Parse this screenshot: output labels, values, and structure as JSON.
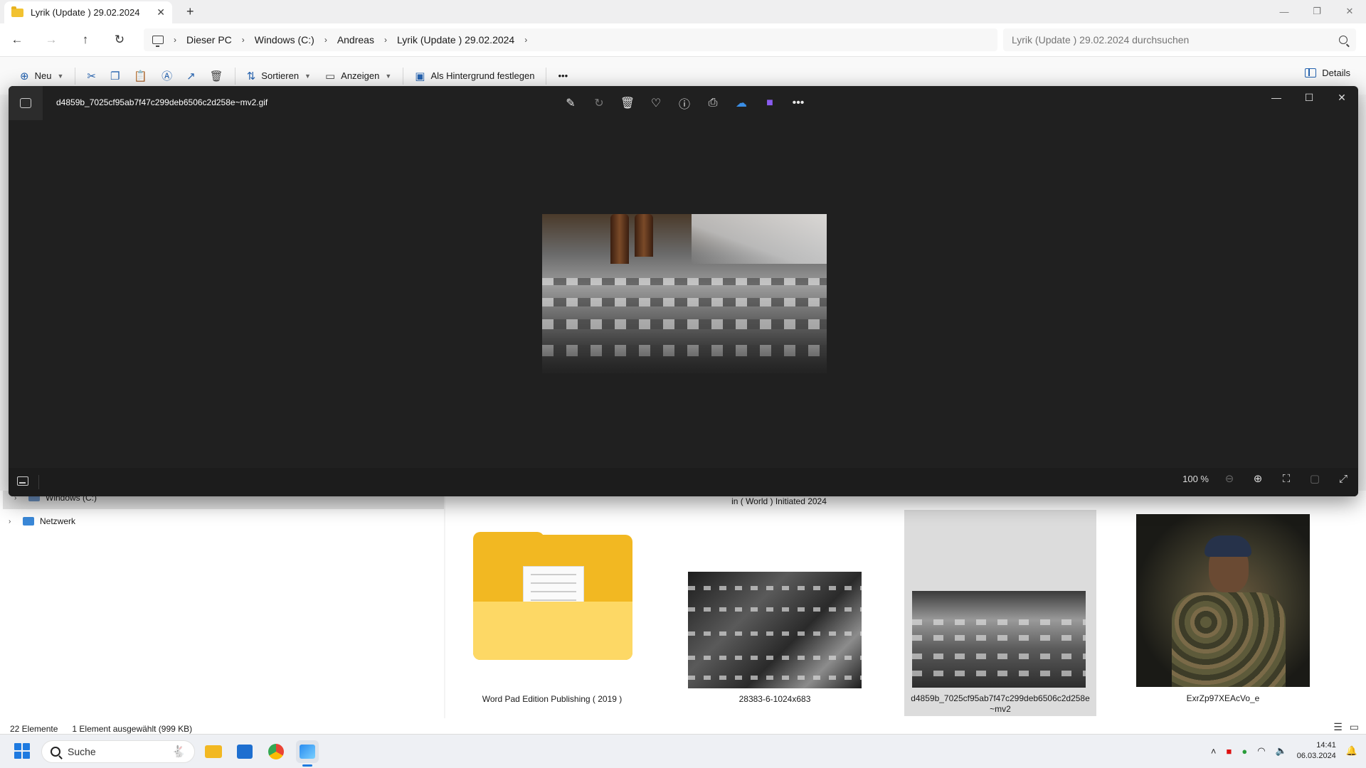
{
  "window": {
    "tab_title": "Lyrik (Update ) 29.02.2024",
    "new_tab_symbol": "+",
    "close_tab_symbol": "✕",
    "minimize_symbol": "—",
    "restore_symbol": "❐",
    "close_symbol": "✕"
  },
  "nav": {
    "back_symbol": "←",
    "forward_symbol": "→",
    "up_symbol": "↑",
    "refresh_symbol": "↻"
  },
  "breadcrumbs": [
    "Dieser PC",
    "Windows (C:)",
    "Andreas",
    "Lyrik (Update ) 29.02.2024"
  ],
  "search": {
    "placeholder": "Lyrik (Update ) 29.02.2024 durchsuchen"
  },
  "commandbar": {
    "new_label": "Neu",
    "sort_label": "Sortieren",
    "view_label": "Anzeigen",
    "wallpaper_label": "Als Hintergrund festlegen",
    "more_symbol": "•••",
    "details_label": "Details",
    "icons": [
      "plus-icon",
      "cut-icon",
      "copy-icon",
      "paste-icon",
      "rename-icon",
      "share-icon",
      "delete-icon"
    ]
  },
  "viewer": {
    "filename": "d4859b_7025cf95ab7f47c299deb6506c2d258e~mv2.gif",
    "zoom": "100 %",
    "more_symbol": "•••",
    "tools": [
      "edit-image-icon",
      "rotate-icon",
      "delete-icon",
      "favorite-heart-icon",
      "info-icon",
      "print-icon",
      "onedrive-icon",
      "clipchamp-icon"
    ]
  },
  "tree": {
    "items": [
      {
        "label": "Windows (C:)"
      },
      {
        "label": "Netzwerk"
      }
    ]
  },
  "files": {
    "partial_label": "in ( World ) Initiated 2024",
    "items": [
      {
        "label": "Word Pad Edition Publishing ( 2019 )",
        "type": "folder"
      },
      {
        "label": "28383-6-1024x683",
        "type": "image"
      },
      {
        "label": "d4859b_7025cf95ab7f47c299deb6506c2d258e~mv2",
        "type": "image",
        "selected": true
      },
      {
        "label": "ExrZp97XEAcVo_e",
        "type": "image"
      }
    ]
  },
  "status": {
    "count": "22 Elemente",
    "selection": "1 Element ausgewählt (999 KB)"
  },
  "taskbar": {
    "search_label": "Suche",
    "time": "14:41",
    "date": "06.03.2024",
    "apps": [
      "file-explorer-icon",
      "microsoft-store-icon",
      "chrome-icon",
      "photos-icon"
    ]
  },
  "colors": {
    "accent": "#1e7ae0",
    "viewer_bg": "#202020",
    "folder": "#f2b822"
  }
}
